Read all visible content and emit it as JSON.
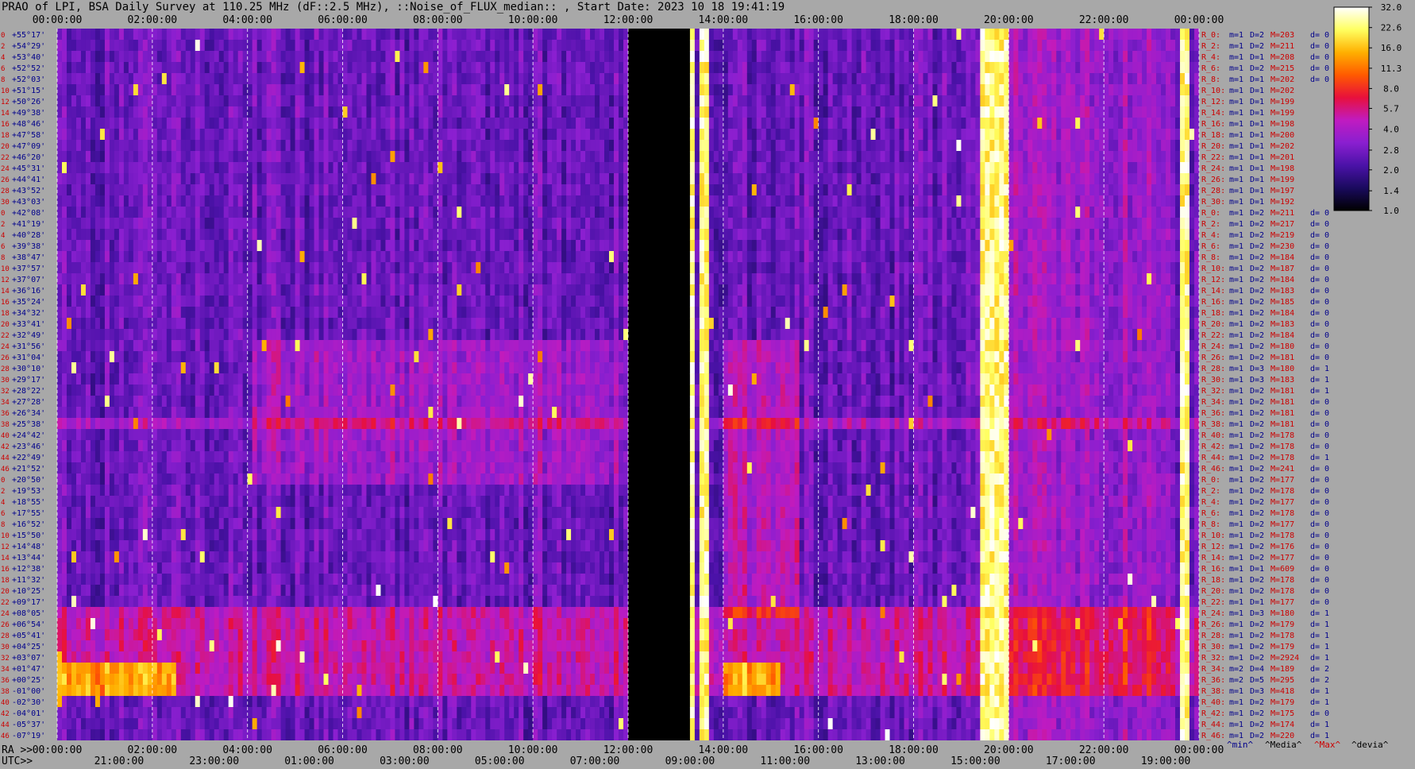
{
  "title": "PRAO of LPI, BSA Daily Survey at 110.25 MHz (dF::2.5 MHz), ::Noise_of_FLUX_median:: , Start Date: 2023 10 18 19:41:19",
  "colors": {
    "background": "#a8a8a8",
    "tick_text": "#000000",
    "row_index": "#cc0000",
    "declination": "#00008b",
    "stats_label": "#cc0000",
    "stats_value": "#00008b",
    "stats_max": "#cc0000"
  },
  "chart_data": {
    "type": "heatmap",
    "x_top_label": "",
    "x_top_ticks": [
      "00:00:00",
      "02:00:00",
      "04:00:00",
      "06:00:00",
      "08:00:00",
      "10:00:00",
      "12:00:00",
      "14:00:00",
      "16:00:00",
      "18:00:00",
      "20:00:00",
      "22:00:00",
      "00:00:00"
    ],
    "x_bottom_ra_label": "RA >>",
    "x_bottom_ra_ticks": [
      "00:00:00",
      "02:00:00",
      "04:00:00",
      "06:00:00",
      "08:00:00",
      "10:00:00",
      "12:00:00",
      "14:00:00",
      "16:00:00",
      "18:00:00",
      "20:00:00",
      "22:00:00",
      "00:00:00"
    ],
    "x_bottom_utc_label": "UTC>>",
    "x_bottom_utc_ticks": [
      "21:00:00",
      "23:00:00",
      "01:00:00",
      "03:00:00",
      "05:00:00",
      "07:00:00",
      "09:00:00",
      "11:00:00",
      "13:00:00",
      "15:00:00",
      "17:00:00",
      "19:00:00"
    ],
    "y_declinations": [
      "+55°17'",
      "+54°29'",
      "+53°40'",
      "+52°52'",
      "+52°03'",
      "+51°15'",
      "+50°26'",
      "+49°38'",
      "+48°46'",
      "+47°58'",
      "+47°09'",
      "+46°20'",
      "+45°31'",
      "+44°41'",
      "+43°52'",
      "+43°03'",
      "+42°08'",
      "+41°19'",
      "+40°28'",
      "+39°38'",
      "+38°47'",
      "+37°57'",
      "+37°07'",
      "+36°16'",
      "+35°24'",
      "+34°32'",
      "+33°41'",
      "+32°49'",
      "+31°56'",
      "+31°04'",
      "+30°10'",
      "+29°17'",
      "+28°22'",
      "+27°28'",
      "+26°34'",
      "+25°38'",
      "+24°42'",
      "+23°46'",
      "+22°49'",
      "+21°52'",
      "+20°50'",
      "+19°53'",
      "+18°55'",
      "+17°55'",
      "+16°52'",
      "+15°50'",
      "+14°48'",
      "+13°44'",
      "+12°38'",
      "+11°32'",
      "+10°25'",
      "+09°17'",
      "+08°05'",
      "+06°54'",
      "+05°41'",
      "+04°25'",
      "+03°07'",
      "+01°47'",
      "+00°25'",
      "-01°00'",
      "-02°30'",
      "-04°01'",
      "-05°37'",
      "-07°19'"
    ],
    "row_indices": [
      "0",
      "2",
      "4",
      "6",
      "8",
      "10",
      "12",
      "14",
      "16",
      "18",
      "20",
      "22",
      "24",
      "26",
      "28",
      "30",
      "0",
      "2",
      "4",
      "6",
      "8",
      "10",
      "12",
      "14",
      "16",
      "18",
      "20",
      "22",
      "24",
      "26",
      "28",
      "30",
      "32",
      "34",
      "36",
      "38",
      "40",
      "42",
      "44",
      "46",
      "0",
      "2",
      "4",
      "6",
      "8",
      "10",
      "12",
      "14",
      "16",
      "18",
      "20",
      "22",
      "24",
      "26",
      "28",
      "30",
      "32",
      "34",
      "36",
      "38",
      "40",
      "42",
      "44",
      "46"
    ],
    "colorbar": {
      "ticks": [
        "32.0",
        "22.6",
        "16.0",
        "11.3",
        "8.0",
        "5.7",
        "4.0",
        "2.8",
        "2.0",
        "1.4",
        "1.0"
      ],
      "range": [
        1.0,
        32.0
      ],
      "scale": "log2",
      "colormap": [
        "#000000",
        "#1a0a5e",
        "#4b12a8",
        "#8a1fd0",
        "#c01bc0",
        "#e8103c",
        "#ff5a00",
        "#ffb000",
        "#ffff60",
        "#ffffff"
      ]
    },
    "rfi_bands": [
      {
        "ra_start": 12.0,
        "ra_end": 13.3,
        "level": "blank"
      },
      {
        "ra_start": 13.35,
        "ra_end": 13.45,
        "level": "saturated"
      },
      {
        "ra_start": 13.55,
        "ra_end": 13.7,
        "level": "saturated"
      },
      {
        "ra_start": 19.4,
        "ra_end": 20.0,
        "level": "saturated"
      },
      {
        "ra_start": 23.55,
        "ra_end": 23.8,
        "level": "saturated"
      }
    ],
    "stats_rows": [
      {
        "label": "R_0:",
        "min": "1",
        "med": "2",
        "max": "203",
        "dev": "0"
      },
      {
        "label": "R_2:",
        "min": "1",
        "med": "2",
        "max": "211",
        "dev": "0"
      },
      {
        "label": "R_4:",
        "min": "1",
        "med": "1",
        "max": "208",
        "dev": "0"
      },
      {
        "label": "R_6:",
        "min": "1",
        "med": "2",
        "max": "215",
        "dev": "0"
      },
      {
        "label": "R_8:",
        "min": "1",
        "med": "1",
        "max": "202",
        "dev": "0"
      },
      {
        "label": "R_10:",
        "min": "1",
        "med": "1",
        "max": "202",
        "dev": ""
      },
      {
        "label": "R_12:",
        "min": "1",
        "med": "1",
        "max": "199",
        "dev": ""
      },
      {
        "label": "R_14:",
        "min": "1",
        "med": "1",
        "max": "199",
        "dev": ""
      },
      {
        "label": "R_16:",
        "min": "1",
        "med": "1",
        "max": "198",
        "dev": ""
      },
      {
        "label": "R_18:",
        "min": "1",
        "med": "1",
        "max": "200",
        "dev": ""
      },
      {
        "label": "R_20:",
        "min": "1",
        "med": "1",
        "max": "202",
        "dev": ""
      },
      {
        "label": "R_22:",
        "min": "1",
        "med": "1",
        "max": "201",
        "dev": ""
      },
      {
        "label": "R_24:",
        "min": "1",
        "med": "1",
        "max": "198",
        "dev": ""
      },
      {
        "label": "R_26:",
        "min": "1",
        "med": "1",
        "max": "199",
        "dev": ""
      },
      {
        "label": "R_28:",
        "min": "1",
        "med": "1",
        "max": "197",
        "dev": ""
      },
      {
        "label": "R_30:",
        "min": "1",
        "med": "1",
        "max": "192",
        "dev": ""
      },
      {
        "label": "R_0:",
        "min": "1",
        "med": "2",
        "max": "211",
        "dev": "0"
      },
      {
        "label": "R_2:",
        "min": "1",
        "med": "2",
        "max": "217",
        "dev": "0"
      },
      {
        "label": "R_4:",
        "min": "1",
        "med": "2",
        "max": "219",
        "dev": "0"
      },
      {
        "label": "R_6:",
        "min": "1",
        "med": "2",
        "max": "230",
        "dev": "0"
      },
      {
        "label": "R_8:",
        "min": "1",
        "med": "2",
        "max": "184",
        "dev": "0"
      },
      {
        "label": "R_10:",
        "min": "1",
        "med": "2",
        "max": "187",
        "dev": "0"
      },
      {
        "label": "R_12:",
        "min": "1",
        "med": "2",
        "max": "184",
        "dev": "0"
      },
      {
        "label": "R_14:",
        "min": "1",
        "med": "2",
        "max": "183",
        "dev": "0"
      },
      {
        "label": "R_16:",
        "min": "1",
        "med": "2",
        "max": "185",
        "dev": "0"
      },
      {
        "label": "R_18:",
        "min": "1",
        "med": "2",
        "max": "184",
        "dev": "0"
      },
      {
        "label": "R_20:",
        "min": "1",
        "med": "2",
        "max": "183",
        "dev": "0"
      },
      {
        "label": "R_22:",
        "min": "1",
        "med": "2",
        "max": "184",
        "dev": "0"
      },
      {
        "label": "R_24:",
        "min": "1",
        "med": "2",
        "max": "180",
        "dev": "0"
      },
      {
        "label": "R_26:",
        "min": "1",
        "med": "2",
        "max": "181",
        "dev": "0"
      },
      {
        "label": "R_28:",
        "min": "1",
        "med": "3",
        "max": "180",
        "dev": "1"
      },
      {
        "label": "R_30:",
        "min": "1",
        "med": "3",
        "max": "183",
        "dev": "1"
      },
      {
        "label": "R_32:",
        "min": "1",
        "med": "2",
        "max": "181",
        "dev": "1"
      },
      {
        "label": "R_34:",
        "min": "1",
        "med": "2",
        "max": "181",
        "dev": "0"
      },
      {
        "label": "R_36:",
        "min": "1",
        "med": "2",
        "max": "181",
        "dev": "0"
      },
      {
        "label": "R_38:",
        "min": "1",
        "med": "2",
        "max": "181",
        "dev": "0"
      },
      {
        "label": "R_40:",
        "min": "1",
        "med": "2",
        "max": "178",
        "dev": "0"
      },
      {
        "label": "R_42:",
        "min": "1",
        "med": "2",
        "max": "178",
        "dev": "0"
      },
      {
        "label": "R_44:",
        "min": "1",
        "med": "2",
        "max": "178",
        "dev": "1"
      },
      {
        "label": "R_46:",
        "min": "1",
        "med": "2",
        "max": "241",
        "dev": "0"
      },
      {
        "label": "R_0:",
        "min": "1",
        "med": "2",
        "max": "177",
        "dev": "0"
      },
      {
        "label": "R_2:",
        "min": "1",
        "med": "2",
        "max": "178",
        "dev": "0"
      },
      {
        "label": "R_4:",
        "min": "1",
        "med": "2",
        "max": "177",
        "dev": "0"
      },
      {
        "label": "R_6:",
        "min": "1",
        "med": "2",
        "max": "178",
        "dev": "0"
      },
      {
        "label": "R_8:",
        "min": "1",
        "med": "2",
        "max": "177",
        "dev": "0"
      },
      {
        "label": "R_10:",
        "min": "1",
        "med": "2",
        "max": "178",
        "dev": "0"
      },
      {
        "label": "R_12:",
        "min": "1",
        "med": "2",
        "max": "176",
        "dev": "0"
      },
      {
        "label": "R_14:",
        "min": "1",
        "med": "2",
        "max": "177",
        "dev": "0"
      },
      {
        "label": "R_16:",
        "min": "1",
        "med": "1",
        "max": "609",
        "dev": "0"
      },
      {
        "label": "R_18:",
        "min": "1",
        "med": "2",
        "max": "178",
        "dev": "0"
      },
      {
        "label": "R_20:",
        "min": "1",
        "med": "2",
        "max": "178",
        "dev": "0"
      },
      {
        "label": "R_22:",
        "min": "1",
        "med": "1",
        "max": "177",
        "dev": "0"
      },
      {
        "label": "R_24:",
        "min": "1",
        "med": "3",
        "max": "180",
        "dev": "1"
      },
      {
        "label": "R_26:",
        "min": "1",
        "med": "2",
        "max": "179",
        "dev": "1"
      },
      {
        "label": "R_28:",
        "min": "1",
        "med": "2",
        "max": "178",
        "dev": "1"
      },
      {
        "label": "R_30:",
        "min": "1",
        "med": "2",
        "max": "179",
        "dev": "1"
      },
      {
        "label": "R_32:",
        "min": "1",
        "med": "2",
        "max": "2924",
        "dev": "1"
      },
      {
        "label": "R_34:",
        "min": "2",
        "med": "4",
        "max": "189",
        "dev": "2"
      },
      {
        "label": "R_36:",
        "min": "2",
        "med": "5",
        "max": "295",
        "dev": "2"
      },
      {
        "label": "R_38:",
        "min": "1",
        "med": "3",
        "max": "418",
        "dev": "1"
      },
      {
        "label": "R_40:",
        "min": "1",
        "med": "2",
        "max": "179",
        "dev": "1"
      },
      {
        "label": "R_42:",
        "min": "1",
        "med": "2",
        "max": "175",
        "dev": "0"
      },
      {
        "label": "R_44:",
        "min": "1",
        "med": "2",
        "max": "174",
        "dev": "1"
      },
      {
        "label": "R_46:",
        "min": "1",
        "med": "2",
        "max": "220",
        "dev": "1"
      }
    ],
    "stats_footer": [
      "^min^",
      "^Media^",
      "^Max^",
      "^devia^"
    ]
  }
}
